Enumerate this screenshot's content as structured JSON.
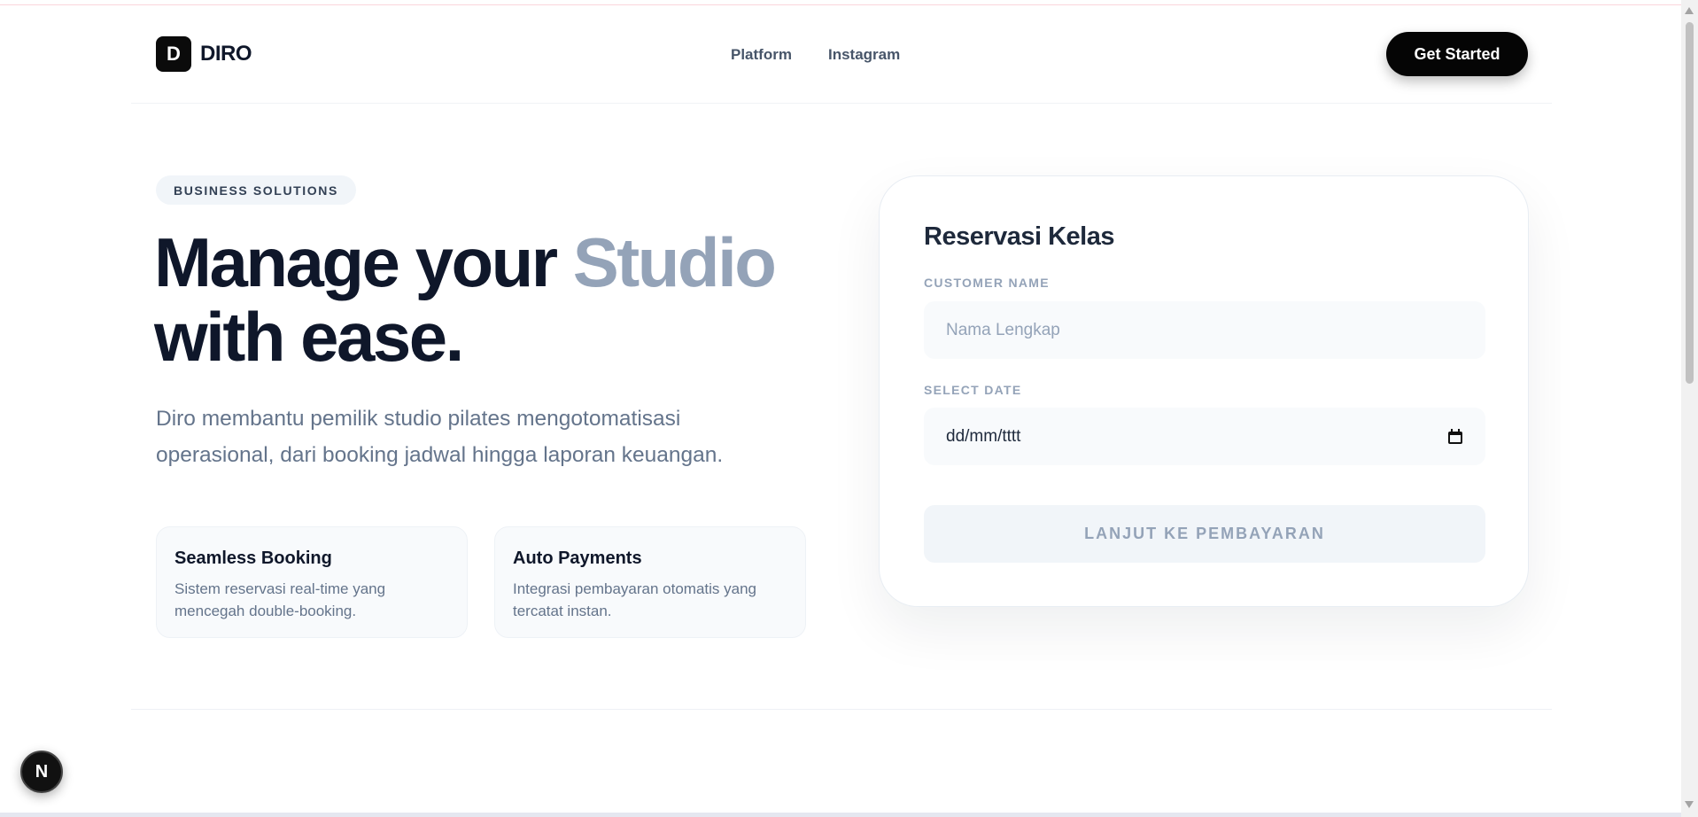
{
  "header": {
    "logo_letter": "D",
    "logo_text": "DIRO",
    "nav": [
      "Platform",
      "Instagram"
    ],
    "cta_label": "Get Started"
  },
  "hero": {
    "badge": "BUSINESS SOLUTIONS",
    "headline_part1": "Manage your ",
    "headline_accent": "Studio",
    "headline_part2": "with ease.",
    "description": "Diro membantu pemilik studio pilates mengotomatisasi operasional, dari booking jadwal hingga laporan keuangan.",
    "features": [
      {
        "title": "Seamless Booking",
        "text": "Sistem reservasi real-time yang mencegah double-booking."
      },
      {
        "title": "Auto Payments",
        "text": "Integrasi pembayaran otomatis yang tercatat instan."
      }
    ]
  },
  "form": {
    "title": "Reservasi Kelas",
    "name_label": "CUSTOMER NAME",
    "name_placeholder": "Nama Lengkap",
    "date_label": "SELECT DATE",
    "date_placeholder": "dd/mm/tttt",
    "submit_label": "LANJUT KE PEMBAYARAN"
  },
  "dev_badge": {
    "letter": "N"
  },
  "colors": {
    "accent": "#94a3b8",
    "text_dark": "#0f172a",
    "button_dark": "#050505"
  },
  "icons": [
    "calendar-icon",
    "next-logo-icon"
  ]
}
